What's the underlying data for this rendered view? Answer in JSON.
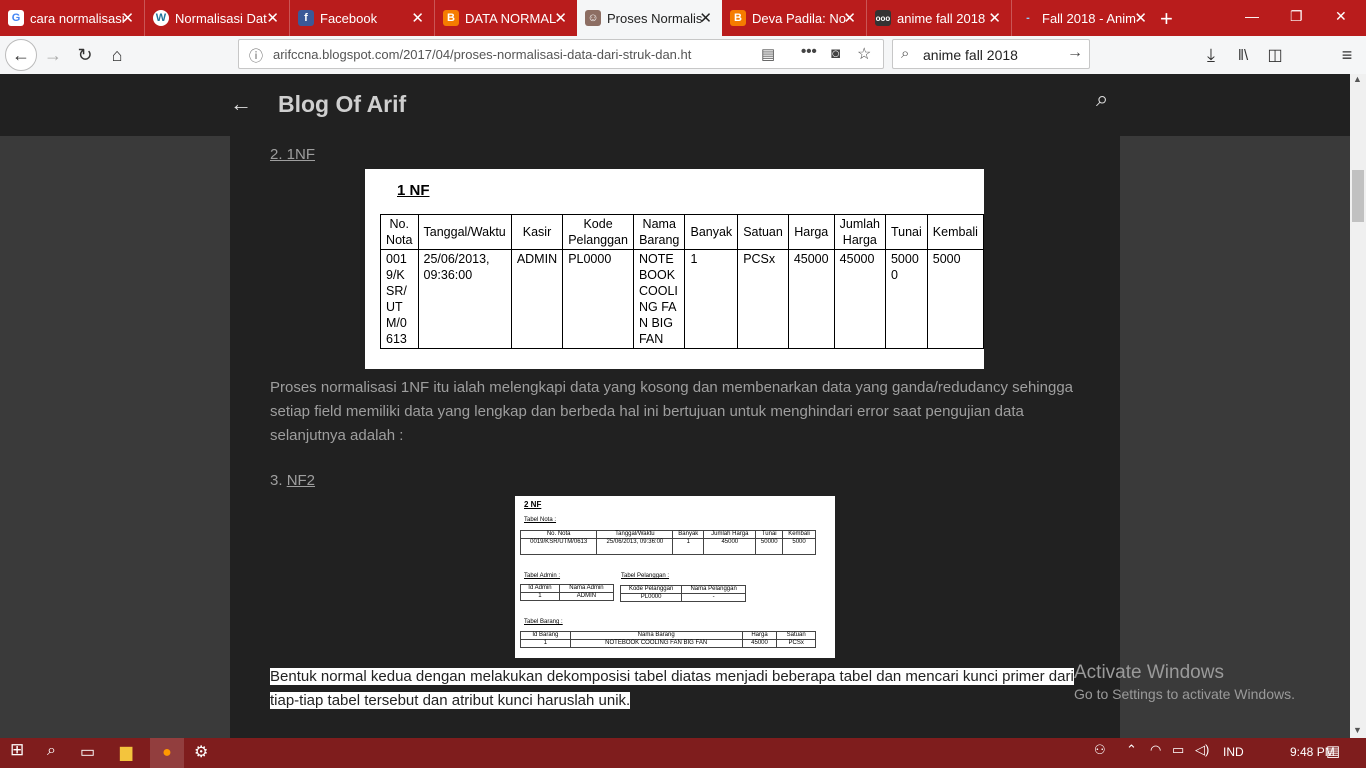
{
  "tabs": [
    {
      "title": "cara normalisasi",
      "favicon": "G"
    },
    {
      "title": "Normalisasi Dat",
      "favicon": "W"
    },
    {
      "title": "Facebook",
      "favicon": "f"
    },
    {
      "title": "DATA NORMAL",
      "favicon": "B"
    },
    {
      "title": "Proses Normalis",
      "favicon": "icon"
    },
    {
      "title": "Deva Padila: No",
      "favicon": "B"
    },
    {
      "title": "anime fall 2018",
      "favicon": "ooo"
    },
    {
      "title": "Fall 2018 - Anim",
      "favicon": "-"
    }
  ],
  "url": "arifccna.blogspot.com/2017/04/proses-normalisasi-data-dari-struk-dan.ht",
  "search_value": "anime fall 2018",
  "blog": {
    "title": "Blog Of Arif"
  },
  "post": {
    "heading1": "2. 1NF",
    "img1": {
      "title": "1 NF",
      "headers": [
        "No. Nota",
        "Tanggal/Waktu",
        "Kasir",
        "Kode Pelanggan",
        "Nama Barang",
        "Banyak",
        "Satuan",
        "Harga",
        "Jumlah Harga",
        "Tunai",
        "Kembali"
      ],
      "row": [
        "0019/KSR/UTM/0613",
        "25/06/2013, 09:36:00",
        "ADMIN",
        "PL0000",
        "NOTEBOOK COOLING FAN BIG FAN",
        "1",
        "PCSx",
        "45000",
        "45000",
        "50000",
        "5000"
      ]
    },
    "para1": "Proses normalisasi 1NF itu ialah melengkapi data yang kosong dan membenarkan data yang ganda/redudancy sehingga setiap field memiliki data yang lengkap dan berbeda hal ini bertujuan untuk menghindari error saat pengujian data selanjutnya adalah :",
    "heading2_prefix": "3. ",
    "heading2_link": "NF2",
    "img2": {
      "title": "2 NF",
      "tabel_nota_label": "Tabel Nota :",
      "nota_headers": [
        "No. Nota",
        "Tanggal/Waktu",
        "Banyak",
        "Jumlah Harga",
        "Tunai",
        "Kembali"
      ],
      "nota_row": [
        "0019/KSR/UTM/0613",
        "25/06/2013, 09:36:00",
        "1",
        "45000",
        "50000",
        "5000"
      ],
      "tabel_admin_label": "Tabel Admin :",
      "admin_headers": [
        "Id Admin",
        "Nama Admin"
      ],
      "admin_row": [
        "1",
        "ADMIN"
      ],
      "tabel_pelanggan_label": "Tabel Pelanggan :",
      "pelanggan_headers": [
        "Kode Pelanggan",
        "Nama Pelanggan"
      ],
      "pelanggan_row": [
        "PL0000",
        "-"
      ],
      "tabel_barang_label": "Tabel Barang :",
      "barang_headers": [
        "Id Barang",
        "Nama Barang",
        "Harga",
        "Satuan"
      ],
      "barang_row": [
        "1",
        "NOTEBOOK COOLING FAN BIG FAN",
        "45000",
        "PCSx"
      ]
    },
    "para2_line1": "Bentuk normal kedua dengan melakukan dekomposisi tabel diatas menjadi beberapa tabel dan mencari kunci primer dari",
    "para2_line2": "tiap-tiap tabel tersebut dan atribut kunci haruslah unik."
  },
  "watermark": {
    "line1": "Activate Windows",
    "line2": "Go to Settings to activate Windows."
  },
  "taskbar": {
    "lang": "IND",
    "time": "9:48 PM"
  },
  "colors": {
    "tabstrip": "#b91c1c",
    "taskbar": "#7f1d1d",
    "blog_bg": "#212121"
  }
}
